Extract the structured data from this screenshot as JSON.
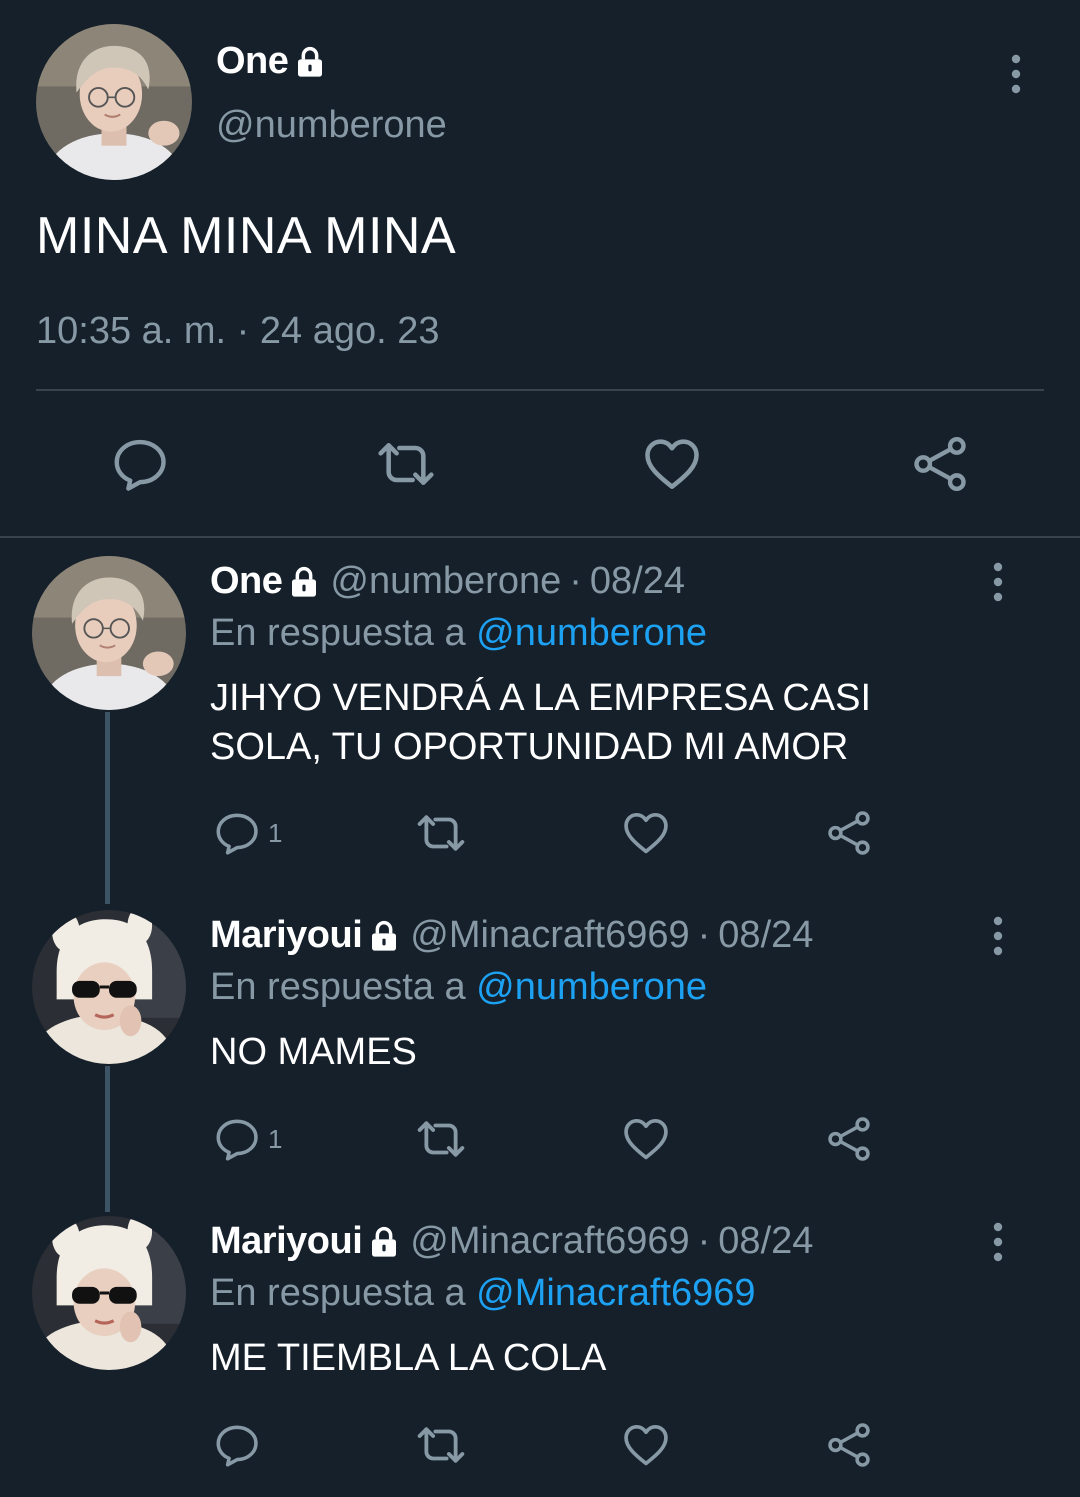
{
  "main_tweet": {
    "name": "One",
    "handle": "@numberone",
    "text": "MINA MINA MINA",
    "timestamp": "10:35 a. m. · 24 ago. 23",
    "actions": [
      "reply-icon",
      "retweet-icon",
      "like-icon",
      "share-icon"
    ]
  },
  "replies": [
    {
      "name": "One",
      "handle": "@numberone",
      "separator": "·",
      "date": "08/24",
      "reply_prefix": "En respuesta a",
      "reply_to": "@numberone",
      "text": "JIHYO VENDRÁ A LA EMPRESA CASI SOLA, TU OPORTUNIDAD MI AMOR",
      "reply_count": "1"
    },
    {
      "name": "Mariyoui",
      "handle": "@Minacraft6969",
      "separator": "·",
      "date": "08/24",
      "reply_prefix": "En respuesta a",
      "reply_to": "@numberone",
      "text": "NO MAMES",
      "reply_count": "1"
    },
    {
      "name": "Mariyoui",
      "handle": "@Minacraft6969",
      "separator": "·",
      "date": "08/24",
      "reply_prefix": "En respuesta a",
      "reply_to": "@Minacraft6969",
      "text": "ME TIEMBLA LA COLA",
      "reply_count": ""
    }
  ],
  "colors": {
    "background": "#15202b",
    "muted": "#8899a6",
    "accent": "#1da1f2",
    "divider": "#38444d",
    "text": "#ffffff"
  }
}
